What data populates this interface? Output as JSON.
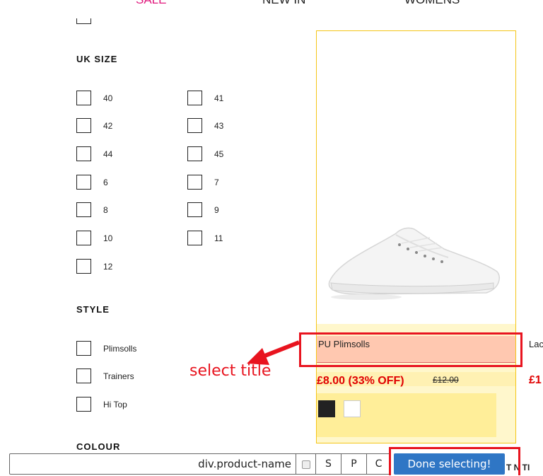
{
  "nav": {
    "sale": "SALE",
    "new_in": "NEW IN",
    "womens": "WOMENS"
  },
  "filters": {
    "uk_size": {
      "heading": "UK SIZE",
      "options": [
        "40",
        "41",
        "42",
        "43",
        "44",
        "45",
        "6",
        "7",
        "8",
        "9",
        "10",
        "11",
        "12"
      ]
    },
    "style": {
      "heading": "STYLE",
      "options": [
        "Plimsolls",
        "Trainers",
        "Hi Top"
      ]
    },
    "colour": {
      "heading": "COLOUR"
    }
  },
  "product": {
    "name": "PU Plimsolls",
    "price": "£8.00 (33% OFF)",
    "old_price": "£12.00",
    "swatches": [
      "#222222",
      "#ffffff"
    ]
  },
  "next_product": {
    "name_fragment": "Lac",
    "price_fragment": "£1",
    "label_fragment": "T N TI"
  },
  "annotation": {
    "text": "select title",
    "color": "#e8141f"
  },
  "selector_toolbar": {
    "selector_value": "div.product-name",
    "buttons": [
      "S",
      "P",
      "C"
    ],
    "done_label": "Done selecting!"
  },
  "colors": {
    "sale": "#e0197d",
    "price": "#e00000",
    "highlight_border": "#f5c518",
    "done_button": "#2f76c5"
  }
}
